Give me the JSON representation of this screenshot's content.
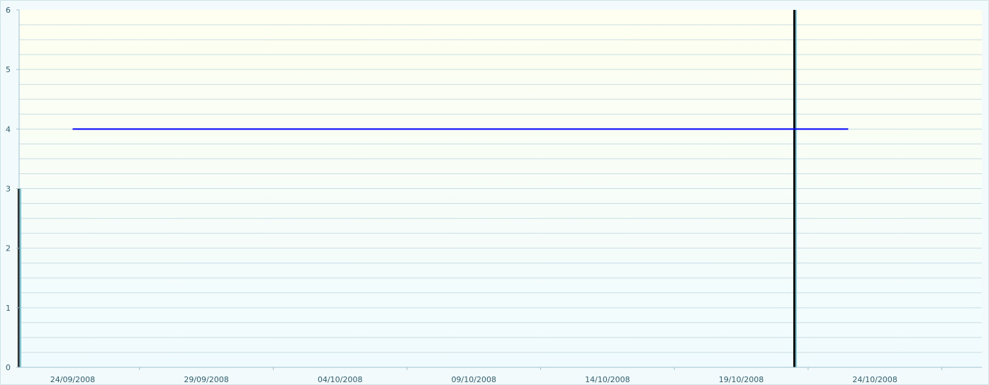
{
  "chart_data": {
    "type": "bar",
    "title": "",
    "xlabel": "",
    "ylabel": "",
    "ylim": [
      0,
      6
    ],
    "y_ticks": [
      "0",
      "1",
      "2",
      "3",
      "4",
      "5",
      "6"
    ],
    "x_range": [
      "22/09/2008",
      "28/10/2008"
    ],
    "x_ticks": [
      "24/09/2008",
      "29/09/2008",
      "04/10/2008",
      "09/10/2008",
      "14/10/2008",
      "19/10/2008",
      "24/10/2008"
    ],
    "grid": true,
    "series": [
      {
        "type": "bar",
        "color": "#000000",
        "points": [
          {
            "x": "22/09/2008",
            "y": 3
          },
          {
            "x": "21/10/2008",
            "y": 6
          }
        ]
      },
      {
        "type": "line",
        "color": "#0000ff",
        "points": [
          {
            "x": "24/09/2008",
            "y": 4
          },
          {
            "x": "23/10/2008",
            "y": 4
          }
        ]
      }
    ]
  }
}
